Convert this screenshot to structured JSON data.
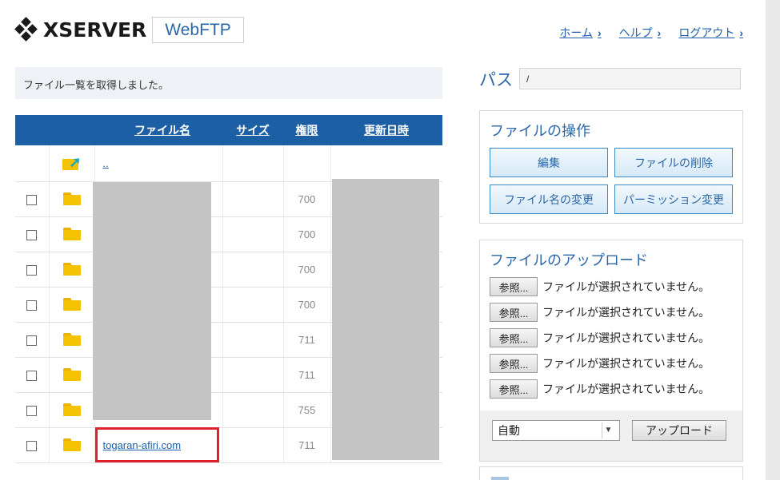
{
  "header": {
    "logo_text": "XSERVER",
    "product": "WebFTP",
    "nav": [
      {
        "label": "ホーム"
      },
      {
        "label": "ヘルプ"
      },
      {
        "label": "ログアウト"
      }
    ]
  },
  "message": "ファイル一覧を取得しました。",
  "table": {
    "headers": {
      "name": "ファイル名",
      "size": "サイズ",
      "perm": "権限",
      "date": "更新日時"
    },
    "parent_link": "..",
    "rows": [
      {
        "name": "",
        "size": "",
        "perm": "700"
      },
      {
        "name": "",
        "size": "",
        "perm": "700"
      },
      {
        "name": "",
        "size": "",
        "perm": "700"
      },
      {
        "name": "",
        "size": "",
        "perm": "700"
      },
      {
        "name": "",
        "size": "",
        "perm": "711"
      },
      {
        "name": "",
        "size": "",
        "perm": "711"
      },
      {
        "name": "",
        "size": "",
        "perm": "755"
      },
      {
        "name": "togaran-afiri.com",
        "size": "",
        "perm": "711"
      }
    ]
  },
  "path": {
    "label": "パス",
    "value": "/"
  },
  "operations": {
    "title": "ファイルの操作",
    "edit": "編集",
    "delete": "ファイルの削除",
    "rename": "ファイル名の変更",
    "permission": "パーミッション変更"
  },
  "upload": {
    "title": "ファイルのアップロード",
    "browse_label": "参照...",
    "no_file": "ファイルが選択されていません。",
    "mode": "自動",
    "submit": "アップロード"
  },
  "colors": {
    "accent": "#1d5fa5",
    "link": "#1d5fae",
    "highlight": "#e0202a"
  }
}
